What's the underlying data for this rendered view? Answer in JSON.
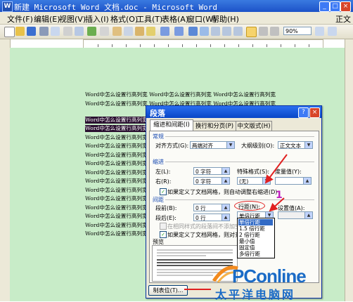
{
  "window": {
    "title": "新建 Microsoft Word 文档.doc - Microsoft Word",
    "app_icon": "W",
    "title_buttons": [
      "_",
      "□",
      "×"
    ]
  },
  "menubar": {
    "items": [
      "文件(F)",
      "编辑(E)",
      "视图(V)",
      "插入(I)",
      "格式(O)",
      "工具(T)",
      "表格(A)",
      "窗口(W)",
      "帮助(H)"
    ],
    "style_box": "正文"
  },
  "toolbar": {
    "zoom": "90%"
  },
  "document": {
    "lines": [
      "Word中怎么设置行高列宽 Word中怎么设置行高列宽 Word中怎么设置行高列宽",
      "Word中怎么设置行高列宽 Word中怎么设置行高列宽 Word中怎么设置行高列宽",
      "Word中怎么设置行高列宽",
      "Word中怎么设置行高列宽",
      "Word中怎么设置行高列宽",
      "Word中怎么设置行高列宽",
      "Word中怎么设置行高列宽",
      "Word中怎么设置行高列宽",
      "Word中怎么设置行高列宽",
      "Word中怎么设置行高列宽",
      "Word中怎么设置行高列宽",
      "Word中怎么设置行高列宽",
      "Word中怎么设置行高列宽",
      "Word中怎么设置行高列宽",
      "Word中怎么设置行高列宽",
      "Word中怎么设置行高列宽"
    ],
    "selected_line_indexes": [
      2,
      3
    ]
  },
  "dialog": {
    "title": "段落",
    "help_button": "?",
    "close_button": "×",
    "tabs": [
      "缩进和间距(I)",
      "换行和分页(P)",
      "中文版式(H)"
    ],
    "general": {
      "group": "常规",
      "align_label": "对齐方式(G):",
      "align_value": "两端对齐",
      "outline_label": "大纲级别(O):",
      "outline_value": "正文文本"
    },
    "indent": {
      "group": "缩进",
      "left_label": "左(L):",
      "left_value": "0 字符",
      "right_label": "右(R):",
      "right_value": "0 字符",
      "special_label": "特殊格式(S):",
      "special_value": "(无)",
      "by_label": "度量值(Y):",
      "grid_check": "如果定义了文档网格，则自动调整右缩进(D)"
    },
    "spacing": {
      "group": "间距",
      "before_label": "段前(B):",
      "before_value": "0 行",
      "after_label": "段后(E):",
      "after_value": "0 行",
      "line_label": "行距(N):",
      "line_value": "单倍行距",
      "at_label": "设置值(A):",
      "no_space_check": "在相同样式的段落间不添加空格(C)",
      "grid_check": "如果定义了文档网格，则对齐网格(W)"
    },
    "line_options": [
      "单倍行距",
      "1.5 倍行距",
      "2 倍行距",
      "最小值",
      "固定值",
      "多倍行距"
    ],
    "line_selected_index": 0,
    "preview_label": "预览",
    "tabs_button": "制表位(T)..."
  },
  "annotation": {
    "step_number": "1"
  },
  "watermark": {
    "brand": "PConline",
    "subtitle": "太平洋电脑网"
  }
}
